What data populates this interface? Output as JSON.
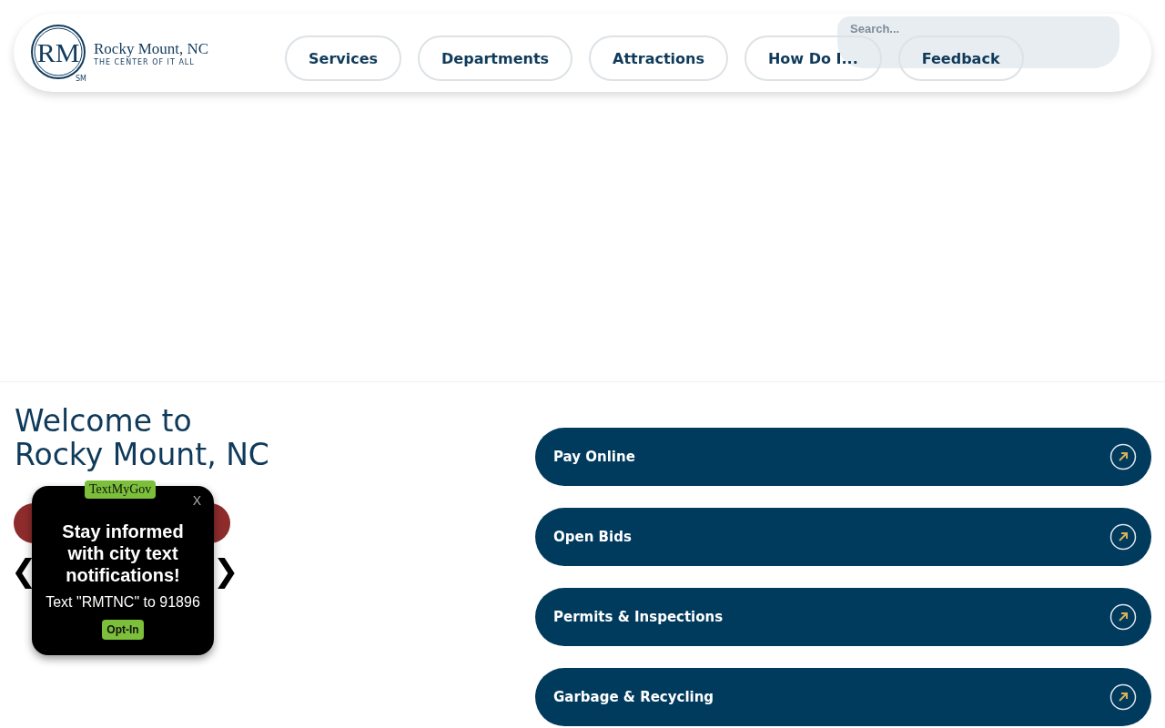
{
  "header": {
    "logo": {
      "monogram": "RM",
      "name": "Rocky Mount, NC",
      "tagline": "THE CENTER OF IT ALL",
      "mark": "SM"
    },
    "nav": [
      {
        "label": "Services"
      },
      {
        "label": "Departments"
      },
      {
        "label": "Attractions"
      },
      {
        "label": "How Do I..."
      },
      {
        "label": "Feedback"
      }
    ],
    "search": {
      "placeholder": "Search..."
    }
  },
  "welcome": {
    "title": "Welcome to Rocky Mount, NC"
  },
  "carousel": {
    "prev": "❮",
    "next": "❯"
  },
  "popup": {
    "brand": "TextMyGov",
    "close": "X",
    "headline": "Stay informed with city text notifications!",
    "instruction": "Text \"RMTNC\" to 91896",
    "button": "Opt-In"
  },
  "quick_links": [
    {
      "label": "Pay Online"
    },
    {
      "label": "Open Bids"
    },
    {
      "label": "Permits & Inspections"
    },
    {
      "label": "Garbage & Recycling"
    }
  ]
}
